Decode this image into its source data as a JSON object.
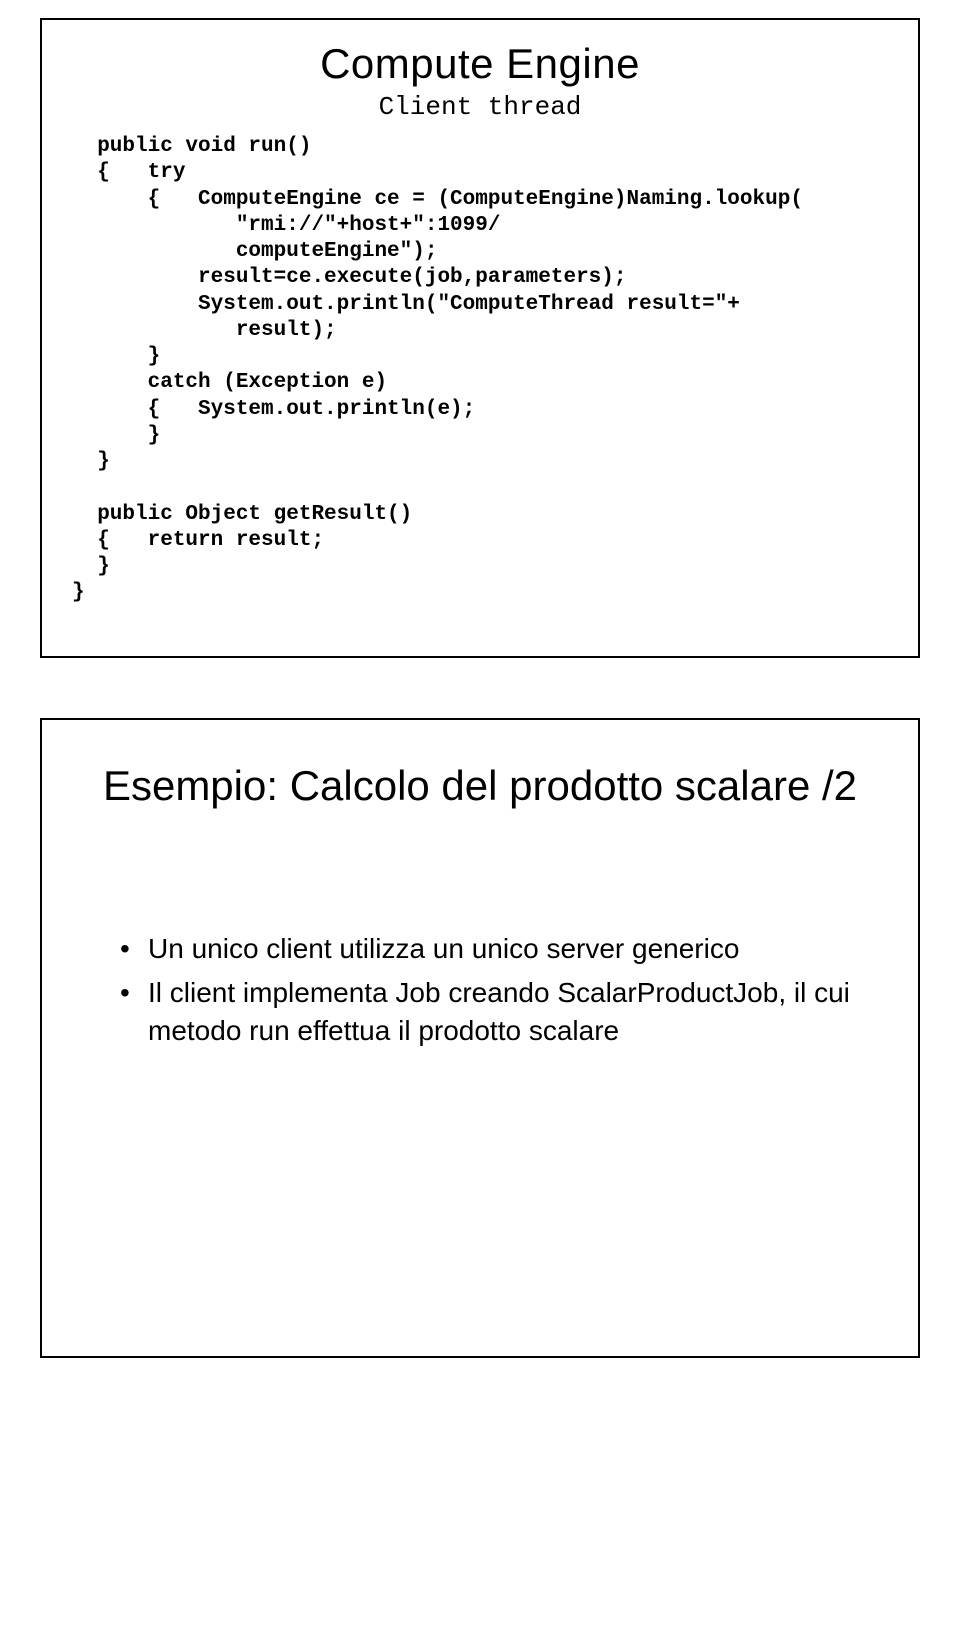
{
  "slide1": {
    "title": "Compute Engine",
    "subtitle": "Client thread",
    "code": "  public void run()\n  {   try\n      {   ComputeEngine ce = (ComputeEngine)Naming.lookup(\n             \"rmi://\"+host+\":1099/\n             computeEngine\");\n          result=ce.execute(job,parameters);\n          System.out.println(\"ComputeThread result=\"+\n             result);\n      }\n      catch (Exception e)\n      {   System.out.println(e);\n      }\n  }\n\n  public Object getResult()\n  {   return result;\n  }\n}"
  },
  "slide2": {
    "title": "Esempio: Calcolo del prodotto scalare /2",
    "bullets": [
      "Un unico client utilizza un unico server generico",
      "Il client implementa Job creando ScalarProductJob, il cui metodo run effettua il prodotto scalare"
    ]
  }
}
